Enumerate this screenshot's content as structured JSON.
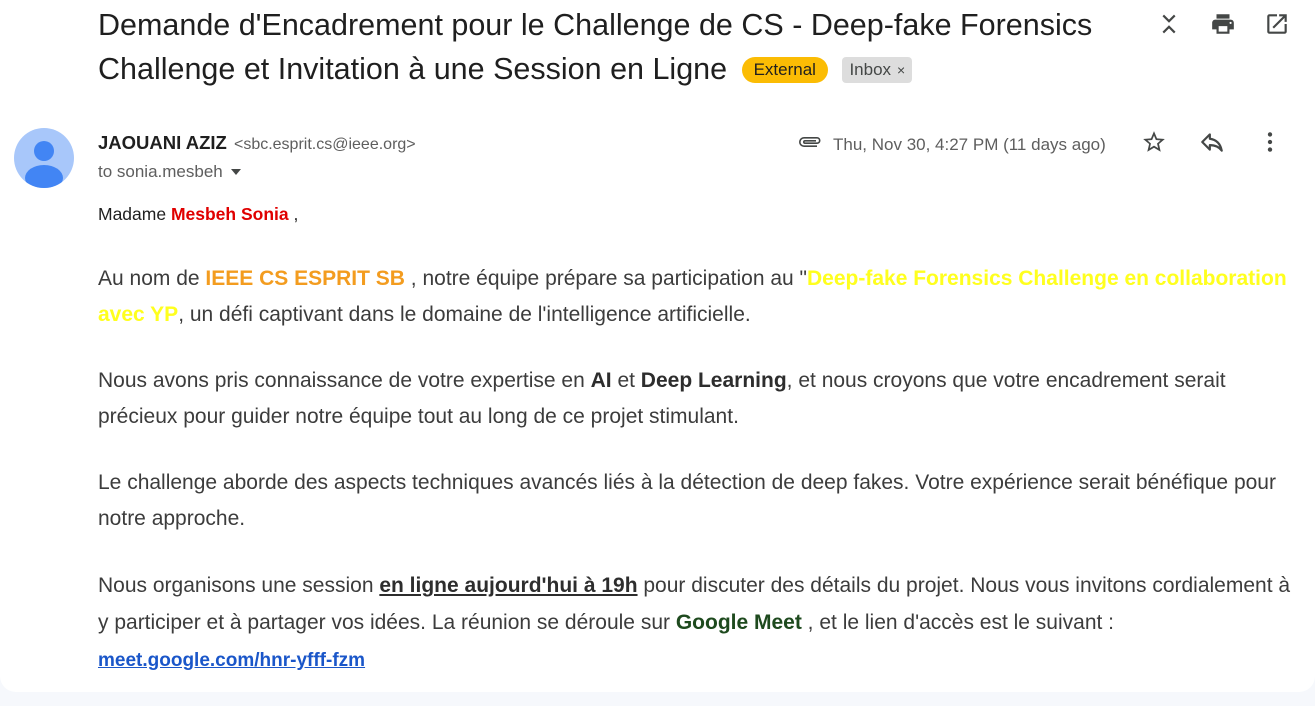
{
  "subject": {
    "title": "Demande d'Encadrement pour le Challenge de CS - Deep-fake Forensics Challenge et Invitation à une Session en Ligne",
    "label_external": "External",
    "label_inbox": "Inbox",
    "label_inbox_remove": "×"
  },
  "toolbar": {
    "icons": [
      "collapse-icon",
      "print-icon",
      "open-in-new-window-icon"
    ]
  },
  "message": {
    "sender_name": "JAOUANI AZIZ",
    "sender_email": "<sbc.esprit.cs@ieee.org>",
    "recipients": "to sonia.mesbeh",
    "date": "Thu, Nov 30, 4:27 PM (11 days ago)",
    "action_icons": [
      "star-icon",
      "reply-icon",
      "more-vert-icon"
    ]
  },
  "body": {
    "greeting_prefix": "Madame ",
    "greeting_name": "Mesbeh Sonia",
    "greeting_suffix": " ,",
    "p1_a": "Au nom de ",
    "p1_org": "IEEE CS ESPRIT SB",
    "p1_b": " , notre équipe prépare sa participation au \"",
    "p1_challenge": "Deep-fake Forensics Challenge en collaboration avec YP",
    "p1_c": ", un défi captivant dans le domaine de l'intelligence artificielle.",
    "p2_a": "Nous avons pris connaissance de votre expertise en ",
    "p2_ai": "AI",
    "p2_b": " et ",
    "p2_dl": "Deep Learning",
    "p2_c": ", et nous croyons que votre encadrement serait précieux pour guider notre équipe tout au long de ce projet stimulant.",
    "p3": "Le challenge aborde des aspects techniques avancés liés à la détection de deep fakes. Votre expérience serait bénéfique pour notre approche.",
    "p4_a": "Nous organisons une session ",
    "p4_when": "en ligne aujourd'hui à 19h",
    "p4_b": " pour discuter des détails du projet. Nous vous invitons cordialement à y participer et à partager vos idées. La réunion se déroule sur ",
    "p4_meet": "Google Meet",
    "p4_c": " , et le lien d'accès est le suivant : ",
    "p4_link": "meet.google.com/hnr-yfff-fzm"
  },
  "colors": {
    "external_chip": "#fbbc04",
    "highlight_red": "#e00000",
    "highlight_orange": "#f39c1f",
    "highlight_yellow": "#ffff1e",
    "meet_green": "#1e4a1e",
    "link_blue": "#1a56c9"
  }
}
